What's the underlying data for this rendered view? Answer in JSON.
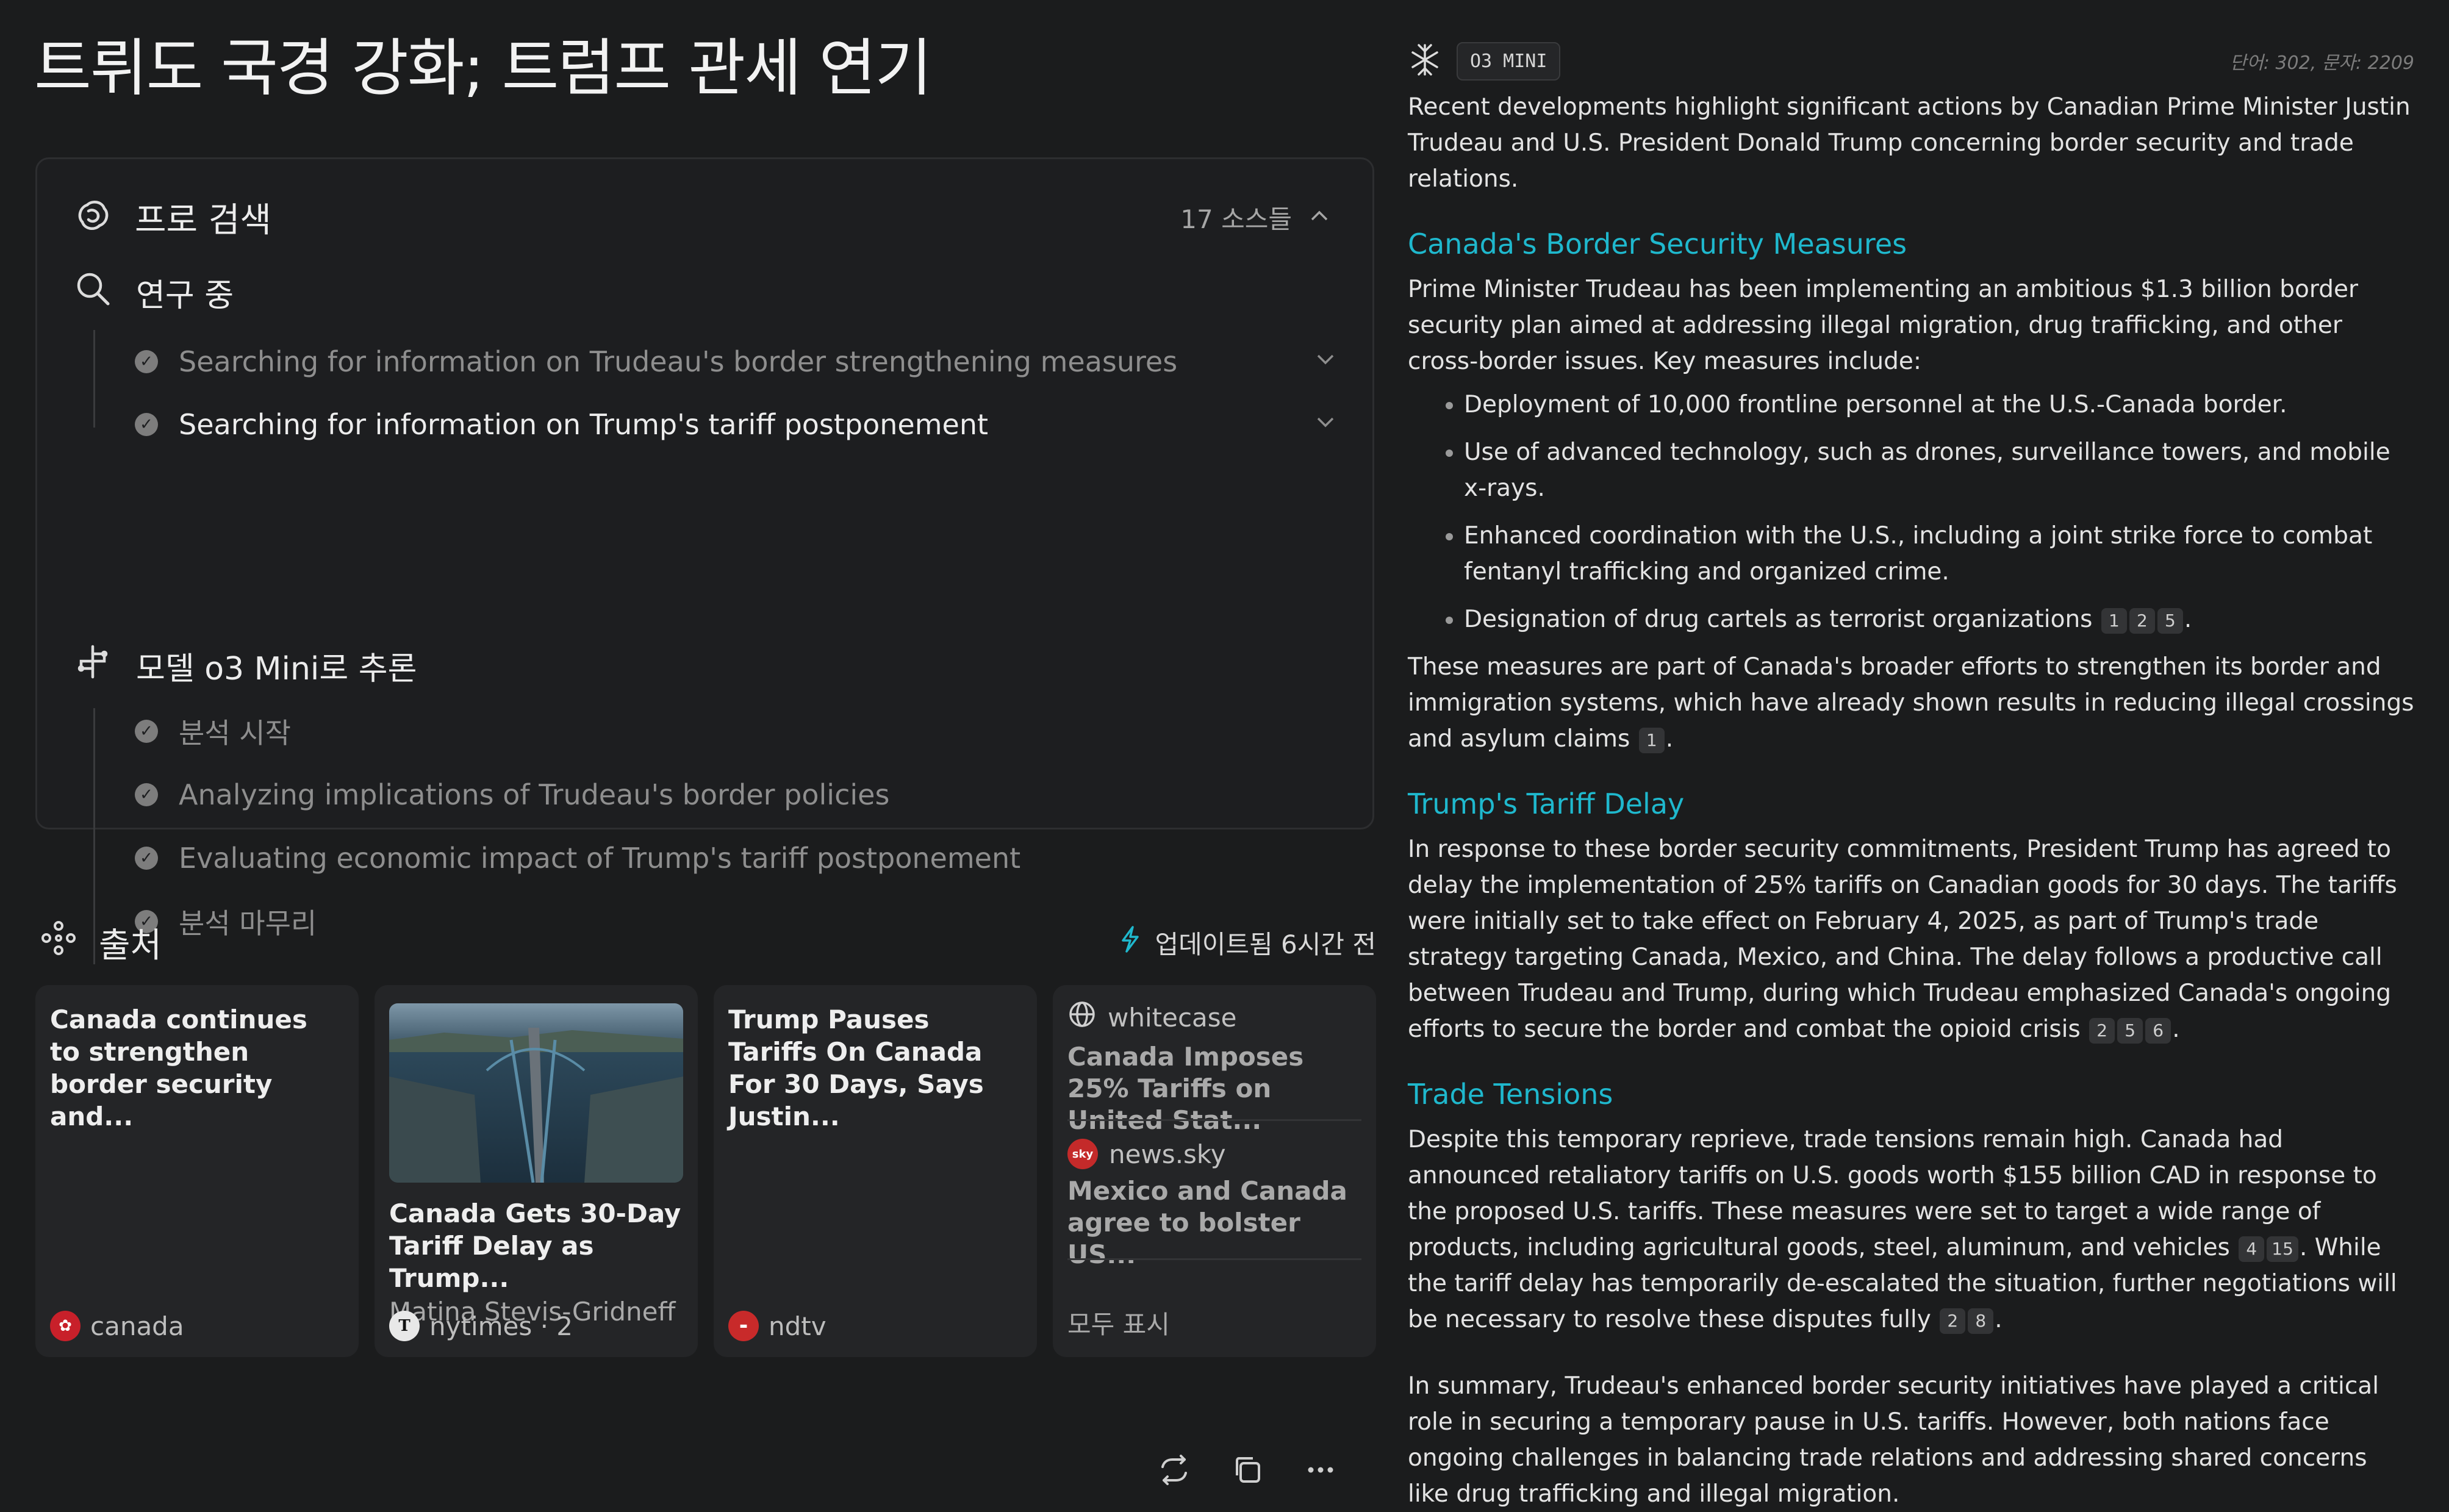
{
  "title": "트뤼도 국경 강화; 트럼프 관세 연기",
  "search_panel": {
    "pro_search_label": "프로 검색",
    "sources_count": "17 소스들",
    "researching_label": "연구 중",
    "research_steps": [
      "Searching for information on Trudeau's border strengthening measures",
      "Searching for information on Trump's tariff postponement"
    ],
    "reasoning_label": "모델 o3 Mini로 추론",
    "reasoning_steps": [
      "분석 시작",
      "Analyzing implications of Trudeau's border policies",
      "Evaluating economic impact of Trump's tariff postponement",
      "분석 마무리"
    ]
  },
  "sources": {
    "label": "출처",
    "updated": "업데이트됨 6시간 전",
    "cards": [
      {
        "title": "Canada continues to strengthen border security and...",
        "site": "canada"
      },
      {
        "title": "Canada Gets 30-Day Tariff Delay as Trump...",
        "author": "Matina Stevis-Gridneff",
        "site": "nytimes · 2"
      },
      {
        "title": "Trump Pauses Tariffs On Canada For 30 Days, Says Justin...",
        "site": "ndtv"
      }
    ],
    "mini": [
      {
        "site": "whitecase",
        "title": "Canada Imposes 25% Tariffs on United Stat..."
      },
      {
        "site": "news.sky",
        "title": "Mexico and Canada agree to bolster US..."
      }
    ],
    "show_all": "모두 표시"
  },
  "answer": {
    "model": "O3 MINI",
    "counts": "단어: 302, 문자: 2209",
    "intro": "Recent developments highlight significant actions by Canadian Prime Minister Justin Trudeau and U.S. President Donald Trump concerning border security and trade relations.",
    "sections": [
      {
        "heading": "Canada's Border Security Measures",
        "para": "Prime Minister Trudeau has been implementing an ambitious $1.3 billion border security plan aimed at addressing illegal migration, drug trafficking, and other cross-border issues. Key measures include:",
        "bullets": [
          "Deployment of 10,000 frontline personnel at the U.S.-Canada border.",
          "Use of advanced technology, such as drones, surveillance towers, and mobile x-rays.",
          "Enhanced coordination with the U.S., including a joint strike force to combat fentanyl trafficking and organized crime.",
          "Designation of drug cartels as terrorist organizations"
        ],
        "bullet_cites": [
          "1",
          "2",
          "5"
        ],
        "after": "These measures are part of Canada's broader efforts to strengthen its border and immigration systems, which have already shown results in reducing illegal crossings and asylum claims",
        "after_cites": [
          "1"
        ]
      },
      {
        "heading": "Trump's Tariff Delay",
        "para": "In response to these border security commitments, President Trump has agreed to delay the implementation of 25% tariffs on Canadian goods for 30 days. The tariffs were initially set to take effect on February 4, 2025, as part of Trump's trade strategy targeting Canada, Mexico, and China. The delay follows a productive call between Trudeau and Trump, during which Trudeau emphasized Canada's ongoing efforts to secure the border and combat the opioid crisis",
        "cites": [
          "2",
          "5",
          "6"
        ]
      },
      {
        "heading": "Trade Tensions",
        "para_a": "Despite this temporary reprieve, trade tensions remain high. Canada had announced retaliatory tariffs on U.S. goods worth $155 billion CAD in response to the proposed U.S. tariffs. These measures were set to target a wide range of products, including agricultural goods, steel, aluminum, and vehicles",
        "cites_a": [
          "4",
          "15"
        ],
        "para_b": ". While the tariff delay has temporarily de-escalated the situation, further negotiations will be necessary to resolve these disputes fully",
        "cites_b": [
          "2",
          "8"
        ]
      }
    ],
    "summary": "In summary, Trudeau's enhanced border security initiatives have played a critical role in securing a temporary pause in U.S. tariffs. However, both nations face ongoing challenges in balancing trade relations and addressing shared concerns like drug trafficking and illegal migration.",
    "period": "."
  },
  "colors": {
    "accent": "#1fb8cd",
    "background": "#1b1c1d",
    "card": "#242527"
  }
}
